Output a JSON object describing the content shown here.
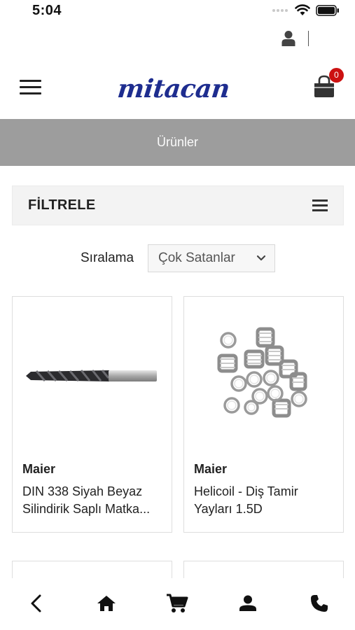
{
  "status_bar": {
    "time": "5:04"
  },
  "header": {
    "logo_text": "mitacan",
    "cart_count": "0",
    "brand_color": "#1e2d8f",
    "badge_color": "#cc1111"
  },
  "page": {
    "title": "Ürünler"
  },
  "filter": {
    "label": "FİLTRELE"
  },
  "sort": {
    "label": "Sıralama",
    "selected": "Çok Satanlar"
  },
  "products": [
    {
      "brand": "Maier",
      "name_line1": "DIN 338 Siyah Beyaz",
      "name_line2": "Silindirik Saplı Matka..."
    },
    {
      "brand": "Maier",
      "name_line1": "Helicoil - Diş Tamir",
      "name_line2": "Yayları 1.5D"
    }
  ],
  "icons": {
    "user": "user-icon",
    "menu": "hamburger-menu-icon",
    "cart": "shopping-bag-icon",
    "filter": "list-icon",
    "sort_chevron": "chevron-down-icon",
    "nav_back": "back-arrow-icon",
    "nav_home": "home-icon",
    "nav_cart": "cart-icon",
    "nav_profile": "user-icon",
    "nav_phone": "phone-icon"
  },
  "colors": {
    "title_bar_bg": "#9d9d9d",
    "filter_bg": "#f3f3f3"
  }
}
